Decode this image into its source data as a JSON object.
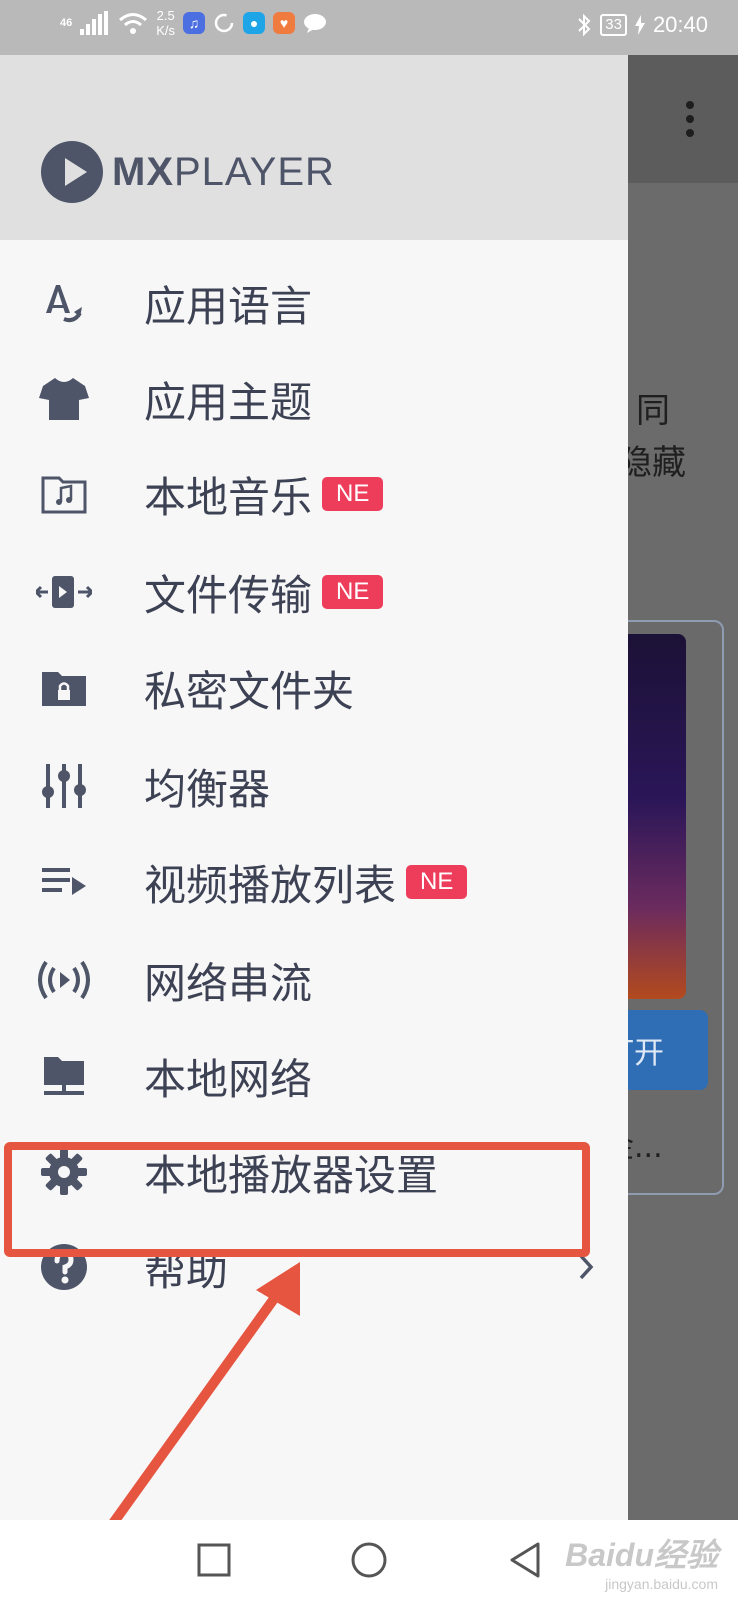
{
  "status_bar": {
    "network_type": "46",
    "speed_value": "2.5",
    "speed_unit": "K/s",
    "battery": "33",
    "time": "20:40"
  },
  "background": {
    "text_line1": "同",
    "text_line2": "隐藏",
    "open_button": "打开",
    "caption": "金..."
  },
  "drawer": {
    "logo": {
      "mx": "MX",
      "player": "PLAYER"
    },
    "items": [
      {
        "label": "应用语言",
        "icon": "language-icon",
        "badge": ""
      },
      {
        "label": "应用主题",
        "icon": "theme-shirt-icon",
        "badge": ""
      },
      {
        "label": "本地音乐",
        "icon": "music-folder-icon",
        "badge": "NE"
      },
      {
        "label": "文件传输",
        "icon": "file-transfer-icon",
        "badge": "NE"
      },
      {
        "label": "私密文件夹",
        "icon": "private-folder-icon",
        "badge": ""
      },
      {
        "label": "均衡器",
        "icon": "equalizer-icon",
        "badge": ""
      },
      {
        "label": "视频播放列表",
        "icon": "playlist-icon",
        "badge": "NE"
      },
      {
        "label": "网络串流",
        "icon": "network-stream-icon",
        "badge": ""
      },
      {
        "label": "本地网络",
        "icon": "local-network-icon",
        "badge": ""
      },
      {
        "label": "本地播放器设置",
        "icon": "gear-icon",
        "badge": ""
      },
      {
        "label": "帮助",
        "icon": "help-icon",
        "badge": ""
      }
    ]
  },
  "watermark": {
    "brand": "Baidu经验",
    "sub": "jingyan.baidu.com"
  },
  "colors": {
    "annotation": "#e65540",
    "badge": "#ee3d5b",
    "icon": "#4e5568",
    "label": "#3d4154"
  }
}
